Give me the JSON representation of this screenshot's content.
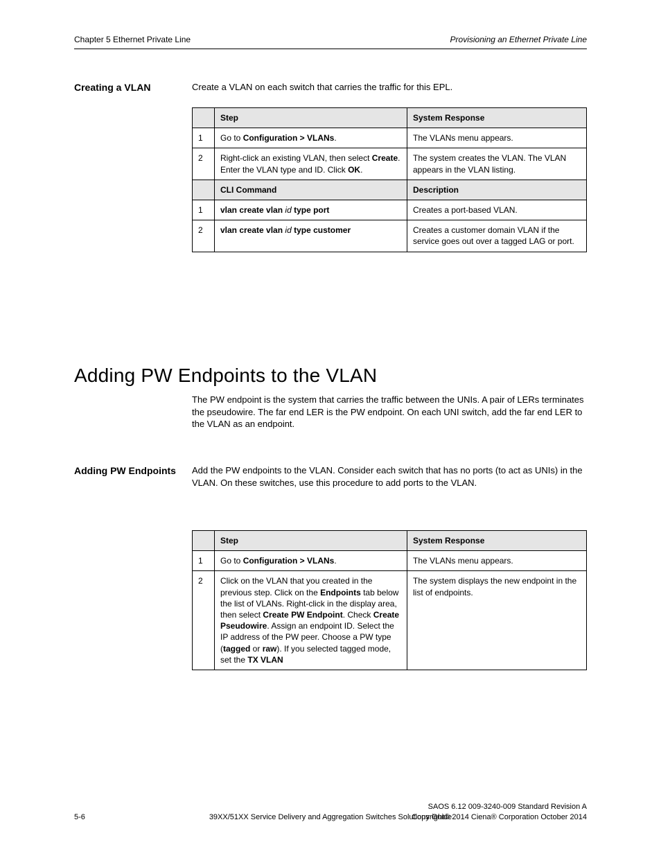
{
  "header": {
    "left": "Chapter 5 Ethernet Private Line",
    "right": "Provisioning an Ethernet Private Line"
  },
  "section1": {
    "label": "Creating a VLAN",
    "intro": "Create a VLAN on each switch that carries the traffic for this EPL.",
    "table": {
      "headers": [
        "",
        "Step",
        "System Response"
      ],
      "rows": [
        {
          "num": "1",
          "step_html": "Go to <b>Configuration > VLANs</b>.",
          "resp": "The VLANs menu appears."
        },
        {
          "num": "2",
          "step_html": "Right-click an existing VLAN, then select <b>Create</b>. Enter the VLAN type and ID. Click <b>OK</b>.",
          "resp": "The system creates the VLAN. The VLAN appears in the VLAN listing."
        }
      ],
      "headers2": [
        "",
        "CLI Command",
        "Description"
      ],
      "rows2": [
        {
          "num": "1",
          "step_html": "<b>vlan create vlan</b> <i>id</i> <b>type port</b>",
          "resp": "Creates a port-based VLAN."
        },
        {
          "num": "2",
          "step_html": "<b>vlan create vlan</b> <i>id</i> <b>type customer</b>",
          "resp": "Creates a customer domain VLAN if the service goes out over a tagged LAG or port."
        }
      ]
    }
  },
  "heading": "Adding PW Endpoints to the VLAN",
  "body_para": "The PW endpoint is the system that carries the traffic between the UNIs. A pair of LERs terminates the pseudowire. The far end LER is the PW endpoint. On each UNI switch, add the far end LER to the VLAN as an endpoint.",
  "section2": {
    "label": "Adding PW Endpoints",
    "intro": "Add the PW endpoints to the VLAN. Consider each switch that has no ports (to act as UNIs) in the VLAN. On these switches, use this procedure to add ports to the VLAN.",
    "table": {
      "headers": [
        "",
        "Step",
        "System Response"
      ],
      "rows": [
        {
          "num": "1",
          "step_html": "Go to <b>Configuration > VLANs</b>.",
          "resp": "The VLANs menu appears."
        },
        {
          "num": "2",
          "step_html": "Click on the VLAN that you created in the previous step. Click on the <b>Endpoints</b> tab below the list of VLANs. Right-click in the display area, then select <b>Create PW Endpoint</b>. Check <b>Create Pseudowire</b>. Assign an endpoint ID. Select the IP address of the PW peer. Choose a PW type (<b>tagged</b> or <b>raw</b>). If you selected tagged mode, set the <b>TX VLAN</b>",
          "resp": "The system displays the new endpoint in the list of endpoints."
        }
      ]
    }
  },
  "footer": {
    "left": "5-6",
    "center": "39XX/51XX Service Delivery and Aggregation Switches Solutions Guide",
    "right": "SAOS 6.12 009-3240-009 Standard Revision A\nCopyright© 2014 Ciena® Corporation October 2014"
  }
}
